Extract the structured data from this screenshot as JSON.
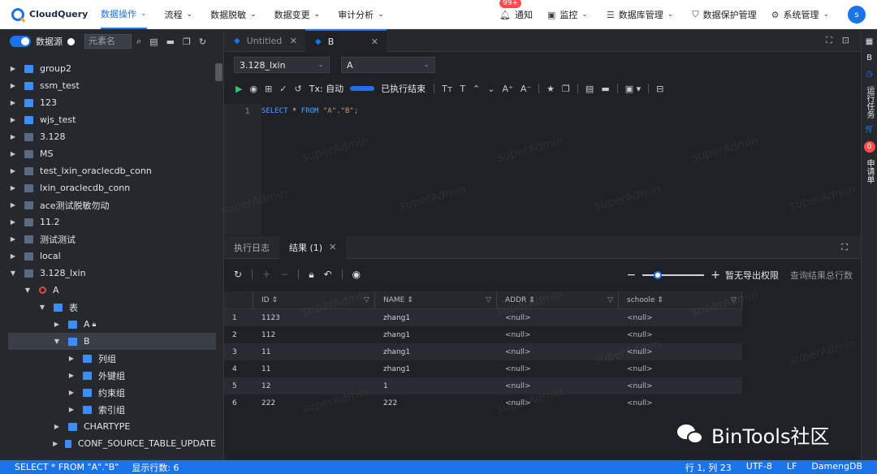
{
  "app": {
    "name": "CloudQuery",
    "avatar": "s"
  },
  "topnav": {
    "items": [
      {
        "label": "数据操作",
        "active": true
      },
      {
        "label": "流程"
      },
      {
        "label": "数据脱敏"
      },
      {
        "label": "数据变更"
      },
      {
        "label": "审计分析"
      }
    ],
    "right": {
      "badge": "99+",
      "notice": "通知",
      "monitor": "监控",
      "dbmanage": "数据库管理",
      "protect": "数据保护管理",
      "sysmanage": "系统管理"
    }
  },
  "sidebar": {
    "datasource_label": "数据源",
    "search_placeholder": "元素名",
    "tree": [
      {
        "label": "group2",
        "icon": "folder-icon",
        "level": 0
      },
      {
        "label": "ssm_test",
        "icon": "folder-icon",
        "level": 0
      },
      {
        "label": "123",
        "icon": "folder-icon",
        "level": 0
      },
      {
        "label": "wjs_test",
        "icon": "folder-icon",
        "level": 0
      },
      {
        "label": "3.128",
        "icon": "db-icon",
        "level": 0
      },
      {
        "label": "MS",
        "icon": "db-icon",
        "level": 0
      },
      {
        "label": "test_lxin_oraclecdb_conn",
        "icon": "db-icon",
        "level": 0
      },
      {
        "label": "lxin_oraclecdb_conn",
        "icon": "db-icon",
        "level": 0
      },
      {
        "label": "ace测试脱敏勿动",
        "icon": "db-icon",
        "level": 0
      },
      {
        "label": "11.2",
        "icon": "db-icon",
        "level": 0
      },
      {
        "label": "测试测试",
        "icon": "db-icon",
        "level": 0
      },
      {
        "label": "local",
        "icon": "db-icon",
        "level": 0
      },
      {
        "label": "3.128_lxin",
        "icon": "db-icon",
        "level": 0,
        "expanded": true
      },
      {
        "label": "A",
        "icon": "schema-icon",
        "level": 1,
        "expanded": true
      },
      {
        "label": "表",
        "icon": "table-group-icon",
        "level": 2,
        "expanded": true
      },
      {
        "label": "A",
        "icon": "table-icon",
        "level": 3,
        "lock": true
      },
      {
        "label": "B",
        "icon": "table-icon",
        "level": 3,
        "expanded": true,
        "selected": true
      },
      {
        "label": "列组",
        "icon": "columns-icon",
        "level": 4
      },
      {
        "label": "外键组",
        "icon": "fk-icon",
        "level": 4
      },
      {
        "label": "约束组",
        "icon": "constraint-icon",
        "level": 4
      },
      {
        "label": "索引组",
        "icon": "index-icon",
        "level": 4
      },
      {
        "label": "CHARTYPE",
        "icon": "table-icon",
        "level": 3
      },
      {
        "label": "CONF_SOURCE_TABLE_UPDATE",
        "icon": "table-icon",
        "level": 3
      }
    ]
  },
  "editor": {
    "tabs": [
      {
        "label": "Untitled"
      },
      {
        "label": "B",
        "active": true
      }
    ],
    "connection": "3.128_lxin",
    "schema": "A",
    "tx_label": "Tx: 自动",
    "exec_status": "已执行结束",
    "line_number": "1",
    "sql": {
      "kw1": "SELECT",
      "star": " * ",
      "kw2": "FROM",
      "rest": " \"A\".\"B\";"
    }
  },
  "results": {
    "tabs": {
      "log": "执行日志",
      "result": "结果 (1)"
    },
    "export_label": "暂无导出权限",
    "count_label": "查询结果总行数",
    "columns": [
      "ID",
      "NAME",
      "ADDR",
      "schoole"
    ],
    "rows": [
      {
        "n": "1",
        "id": "1123",
        "name": "zhang1",
        "addr": "<null>",
        "schoole": "<null>"
      },
      {
        "n": "2",
        "id": "112",
        "name": "zhang1",
        "addr": "<null>",
        "schoole": "<null>"
      },
      {
        "n": "3",
        "id": "11",
        "name": "zhang1",
        "addr": "<null>",
        "schoole": "<null>"
      },
      {
        "n": "4",
        "id": "11",
        "name": "zhang1",
        "addr": "<null>",
        "schoole": "<null>"
      },
      {
        "n": "5",
        "id": "12",
        "name": "1",
        "addr": "<null>",
        "schoole": "<null>"
      },
      {
        "n": "6",
        "id": "222",
        "name": "222",
        "addr": "<null>",
        "schoole": "<null>"
      }
    ]
  },
  "rightbar": {
    "b": "B",
    "tasks": "运行任务",
    "cart_count": "0",
    "apply": "申请单"
  },
  "status": {
    "sql": "SELECT * FROM \"A\".\"B\"",
    "rows": "显示行数: 6",
    "pos": "行 1, 列 23",
    "enc": "UTF-8",
    "eol": "LF",
    "db": "DamengDB"
  },
  "watermark": "superAdmin",
  "brand": "BinTools社区"
}
